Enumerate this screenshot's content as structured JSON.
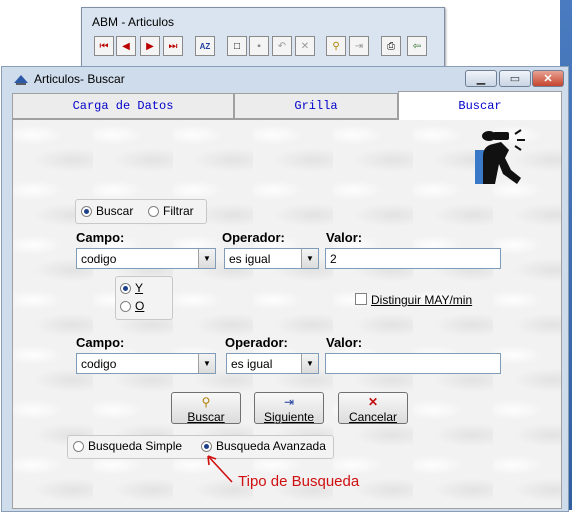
{
  "toolbar_window": {
    "title": "ABM - Articulos",
    "buttons": [
      {
        "icon": "first-record-icon",
        "glyph": "⏮"
      },
      {
        "icon": "previous-record-icon",
        "glyph": "◀"
      },
      {
        "icon": "next-record-icon",
        "glyph": "▶"
      },
      {
        "icon": "last-record-icon",
        "glyph": "⏭"
      },
      {
        "icon": "sort-az-icon",
        "glyph": "AZ"
      },
      {
        "icon": "new-document-icon",
        "glyph": "□"
      },
      {
        "icon": "save-icon",
        "glyph": "▪"
      },
      {
        "icon": "undo-icon",
        "glyph": "↶"
      },
      {
        "icon": "delete-icon",
        "glyph": "✕"
      },
      {
        "icon": "find-icon",
        "glyph": "⚲"
      },
      {
        "icon": "find-next-icon",
        "glyph": "⇥"
      },
      {
        "icon": "print-icon",
        "glyph": "⎙"
      },
      {
        "icon": "exit-icon",
        "glyph": "⇦"
      }
    ]
  },
  "window": {
    "title": "Articulos- Buscar",
    "tabs": [
      {
        "label": "Carga de Datos",
        "active": false
      },
      {
        "label": "Grilla",
        "active": false
      },
      {
        "label": "Buscar",
        "active": true
      }
    ]
  },
  "form": {
    "mode_buscar": "Buscar",
    "mode_filtrar": "Filtrar",
    "row1": {
      "campo_label": "Campo:",
      "campo_value": "codigo",
      "operador_label": "Operador:",
      "operador_value": "es igual",
      "valor_label": "Valor:",
      "valor_value": "2"
    },
    "logic_y": "Y",
    "logic_o": "O",
    "distinguir_label": "Distinguir MAY/min",
    "row2": {
      "campo_label": "Campo:",
      "campo_value": "codigo",
      "operador_label": "Operador:",
      "operador_value": "es igual",
      "valor_label": "Valor:",
      "valor_value": ""
    },
    "buttons": {
      "buscar": "Buscar",
      "siguiente": "Siguiente",
      "cancelar": "Cancelar"
    },
    "busqueda_simple": "Busqueda Simple",
    "busqueda_avanzada": "Busqueda Avanzada"
  },
  "annotation": {
    "text": "Tipo de Busqueda",
    "color": "#d01010"
  }
}
